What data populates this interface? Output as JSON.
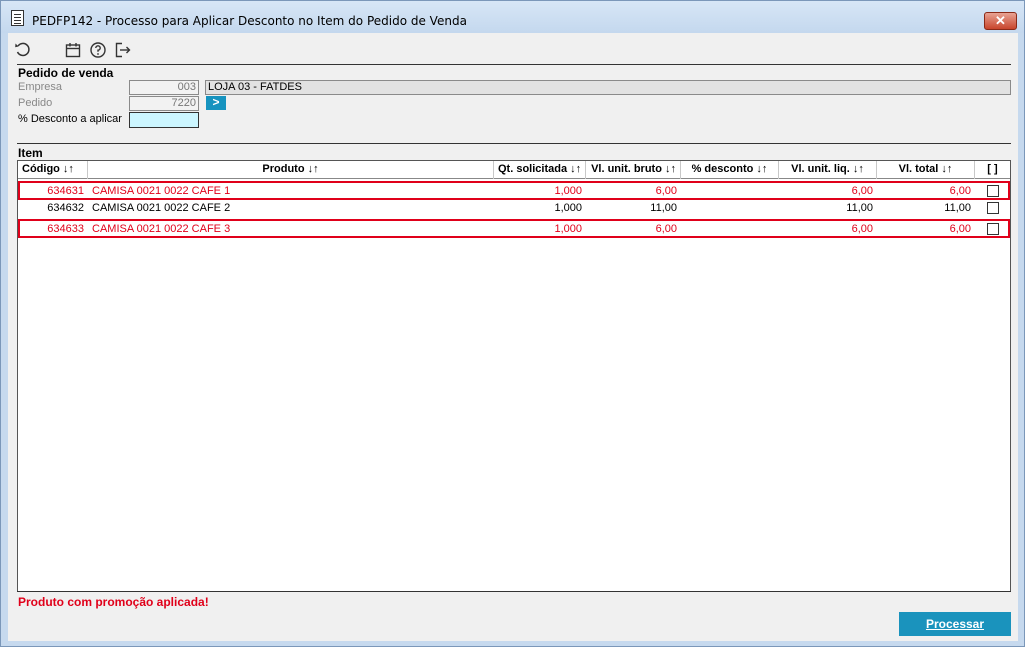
{
  "window": {
    "title": "PEDFP142 - Processo para Aplicar Desconto no Item do Pedido de Venda",
    "close_label": "✕"
  },
  "toolbar": {
    "icons": [
      "refresh-icon",
      "calendar-icon",
      "help-icon",
      "exit-icon"
    ]
  },
  "pedido": {
    "section_title": "Pedido de venda",
    "empresa_label": "Empresa",
    "empresa_value": "003",
    "empresa_desc": "LOJA 03 - FATDES",
    "pedido_label": "Pedido",
    "pedido_value": "7220",
    "go_label": ">",
    "desconto_label": "% Desconto a aplicar",
    "desconto_value": ""
  },
  "item": {
    "section_title": "Item",
    "columns": {
      "codigo": "Código ↓↑",
      "produto": "Produto ↓↑",
      "qt": "Qt. solicitada ↓↑",
      "vl_bruto": "Vl. unit. bruto ↓↑",
      "desconto": "% desconto ↓↑",
      "vl_liq": "Vl. unit. liq. ↓↑",
      "vl_total": "Vl. total ↓↑",
      "sel": "[ ]"
    },
    "rows": [
      {
        "codigo": "634631",
        "produto": "CAMISA 0021 0022 CAFE 1",
        "qt": "1,000",
        "vl_bruto": "6,00",
        "desconto": "",
        "vl_liq": "6,00",
        "vl_total": "6,00",
        "promo": true,
        "checked": false
      },
      {
        "codigo": "634632",
        "produto": "CAMISA 0021 0022 CAFE 2",
        "qt": "1,000",
        "vl_bruto": "11,00",
        "desconto": "",
        "vl_liq": "11,00",
        "vl_total": "11,00",
        "promo": false,
        "checked": false
      },
      {
        "codigo": "634633",
        "produto": "CAMISA 0021 0022 CAFE 3",
        "qt": "1,000",
        "vl_bruto": "6,00",
        "desconto": "",
        "vl_liq": "6,00",
        "vl_total": "6,00",
        "promo": true,
        "checked": false
      }
    ]
  },
  "status": {
    "message": "Produto com promoção aplicada!",
    "color": "#e0001a"
  },
  "actions": {
    "process_label": "Processar",
    "accent": "#1a93bd"
  }
}
